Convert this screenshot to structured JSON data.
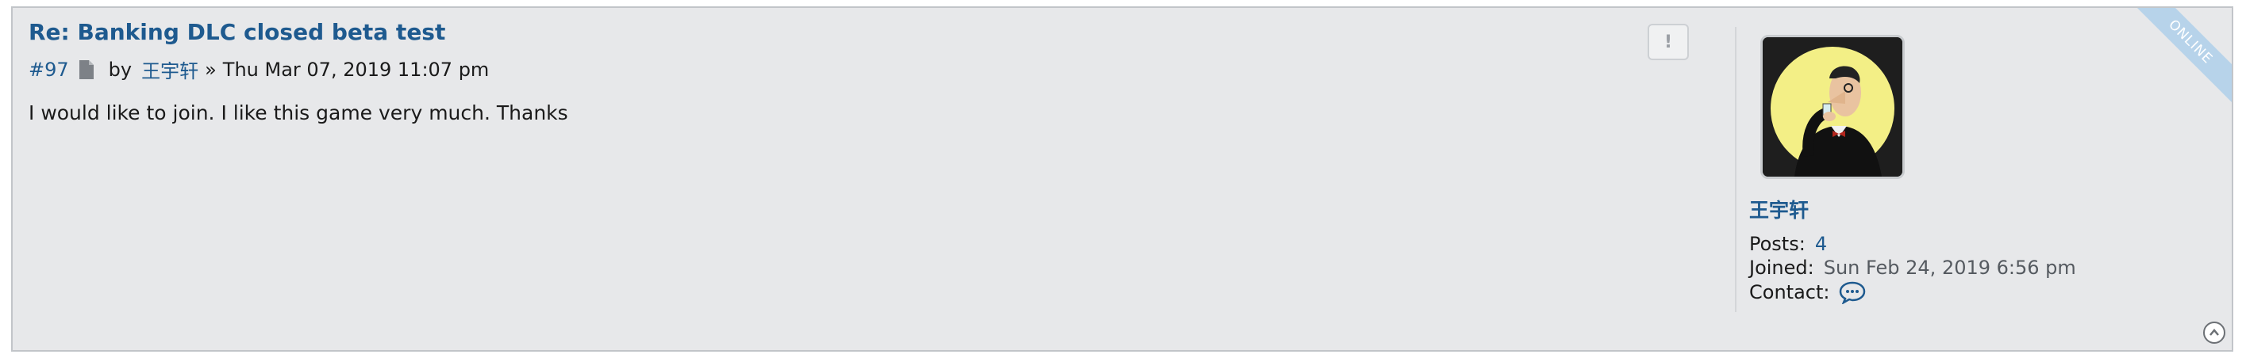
{
  "post": {
    "title": "Re: Banking DLC closed beta test",
    "number": "#97",
    "by_label": "by",
    "author": "王宇轩",
    "separator": "»",
    "datetime": "Thu Mar 07, 2019 11:07 pm",
    "content": "I would like to join. I like this game very much. Thanks"
  },
  "report_button": {
    "label": "!"
  },
  "profile": {
    "username": "王宇轩",
    "posts_label": "Posts:",
    "posts_value": "4",
    "joined_label": "Joined:",
    "joined_value": "Sun Feb 24, 2019 6:56 pm",
    "contact_label": "Contact:",
    "online_badge": "ONLINE"
  },
  "icons": {
    "post_icon": "document-icon",
    "contact_icon": "speech-bubble-icon",
    "back_to_top_icon": "chevron-up-circle-icon"
  },
  "colors": {
    "link": "#1e5a8f",
    "panel_bg": "#e7e8ea",
    "online_ribbon": "#b7d3ea"
  }
}
